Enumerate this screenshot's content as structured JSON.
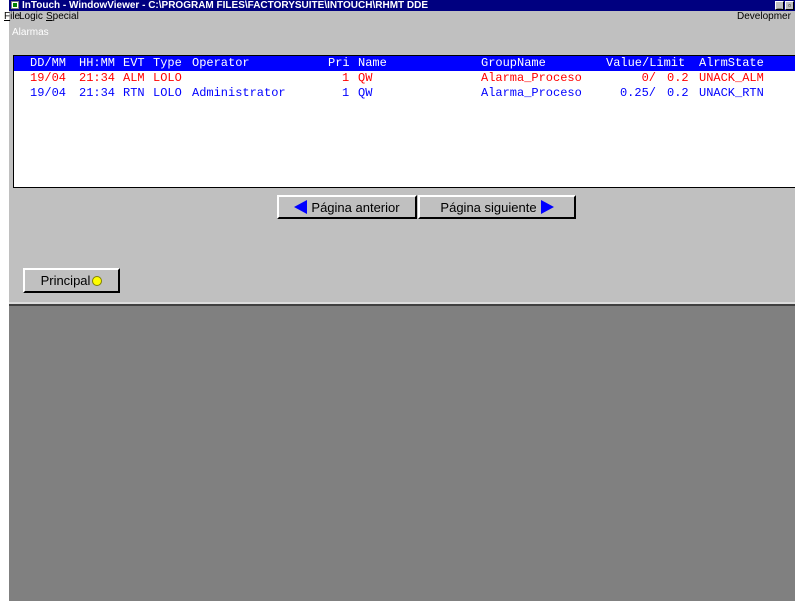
{
  "window": {
    "title": "InTouch - WindowViewer - C:\\PROGRAM FILES\\FACTORYSUITE\\INTOUCH\\RHMT DDE"
  },
  "menu": {
    "items": [
      {
        "label": "File",
        "mnemonic": "F",
        "rest": "ile"
      },
      {
        "label": "Logic",
        "mnemonic": "",
        "rest": "Logic"
      },
      {
        "label": "Special",
        "mnemonic": "S",
        "rest": "pecial"
      }
    ],
    "right_label": "Developmer"
  },
  "section_label": "Alarmas",
  "alarms": {
    "headers": {
      "date": "DD/MM",
      "time": "HH:MM",
      "evt": "EVT",
      "type": "Type",
      "operator": "Operator",
      "pri": "Pri",
      "name": "Name",
      "group": "GroupName",
      "value": "Value/Limit",
      "state": "AlrmState"
    },
    "rows": [
      {
        "date": "19/04",
        "time": "21:34",
        "evt": "ALM",
        "type": "LOLO",
        "operator": "",
        "pri": "1",
        "name": "QW",
        "group": "Alarma_Proceso",
        "value": "0/",
        "limit": "0.2",
        "state": "UNACK_ALM",
        "color": "#ff0000"
      },
      {
        "date": "19/04",
        "time": "21:34",
        "evt": "RTN",
        "type": "LOLO",
        "operator": "Administrator",
        "pri": "1",
        "name": "QW",
        "group": "Alarma_Proceso",
        "value": "0.25/",
        "limit": "0.2",
        "state": "UNACK_RTN",
        "color": "#0000ff"
      }
    ]
  },
  "nav": {
    "prev_label": "Página anterior",
    "next_label": "Página siguiente",
    "principal_label": "Principal"
  },
  "colors": {
    "titlebar": "#000080",
    "header_bg": "#0000ff",
    "alarm_active": "#ff0000",
    "alarm_return": "#0000ff",
    "indicator": "#ffff00",
    "workspace": "#808080"
  }
}
